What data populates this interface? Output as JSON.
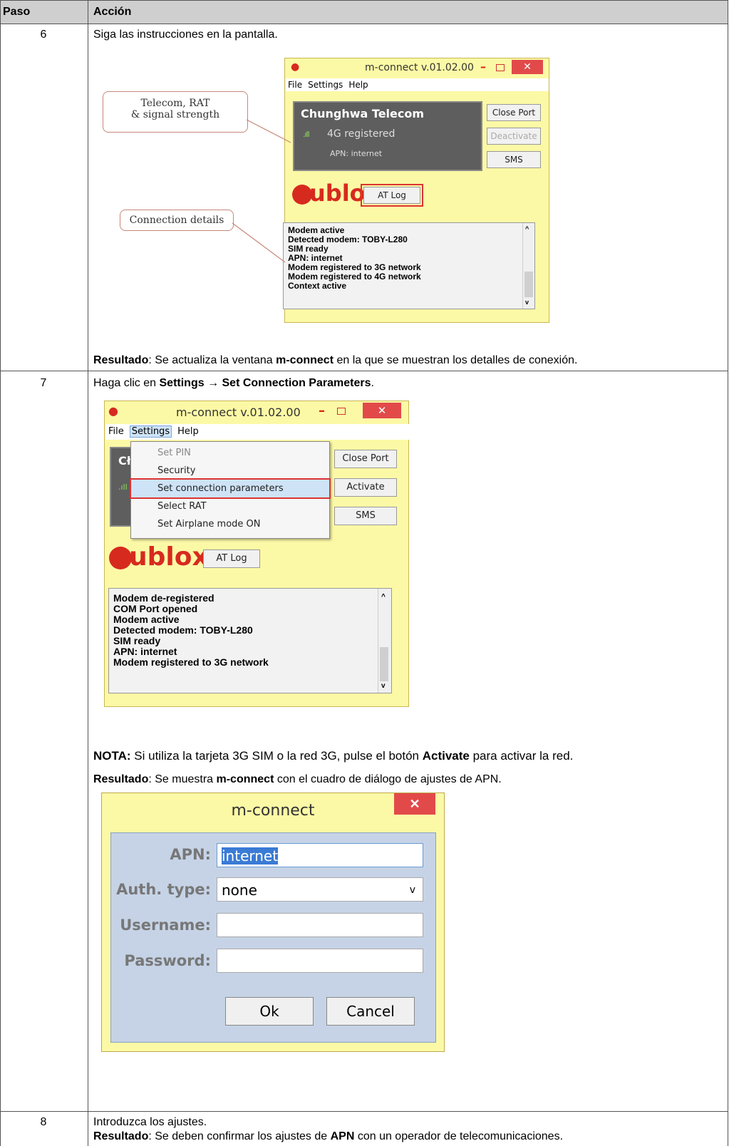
{
  "table": {
    "col_step": "Paso",
    "col_action": "Acción"
  },
  "step6": {
    "num": "6",
    "instruction": "Siga las instrucciones en la pantalla.",
    "result_label": "Resultado",
    "result_pre": ": Se actualiza la ventana ",
    "result_bold": "m-connect",
    "result_post": " en la que se muestran los detalles de conexión.",
    "callout1": "Telecom, RAT & signal strength",
    "callout1_line1": "Telecom, RAT",
    "callout1_line2": "& signal strength",
    "callout2": "Connection details",
    "window": {
      "title": "m-connect v.01.02.00",
      "menu": [
        "File",
        "Settings",
        "Help"
      ],
      "operator": "Chunghwa Telecom",
      "status": "4G registered",
      "apn": "APN: internet",
      "btn_close_port": "Close Port",
      "btn_deactivate": "Deactivate",
      "btn_sms": "SMS",
      "brand": "ublox",
      "btn_at_log": "AT Log",
      "log": [
        "Modem active",
        "Detected modem: TOBY-L280",
        "SIM ready",
        "APN: internet",
        "Modem registered to 3G network",
        "Modem registered to 4G network",
        "Context active"
      ]
    }
  },
  "step7": {
    "num": "7",
    "instr_pre": "Haga clic en ",
    "instr_bold": "Settings → Set Connection Parameters",
    "instr_post": ".",
    "window": {
      "title": "m-connect v.01.02.00",
      "menu": [
        "File",
        "Settings",
        "Help"
      ],
      "operator_partial": "Cł",
      "dropdown": [
        "Set PIN",
        "Security",
        "Set connection parameters",
        "Select RAT",
        "Set Airplane mode ON"
      ],
      "btn_close_port": "Close Port",
      "btn_activate": "Activate",
      "btn_sms": "SMS",
      "brand": "ublox",
      "btn_at_log": "AT Log",
      "log": [
        "Modem de-registered",
        "COM Port opened",
        "Modem active",
        "Detected modem: TOBY-L280",
        "SIM ready",
        "APN: internet",
        "Modem registered to 3G network"
      ]
    },
    "note_label": "NOTA:",
    "note_pre": " Si utiliza la tarjeta 3G SIM o la red 3G, pulse el botón ",
    "note_bold": "Activate",
    "note_post": " para activar la red.",
    "result_label": "Resultado",
    "result_pre": ": Se muestra ",
    "result_bold": "m-connect",
    "result_post": " con el cuadro de diálogo de ajustes de APN.",
    "dialog": {
      "title": "m-connect",
      "apn_label": "APN:",
      "apn_value": "internet",
      "auth_label": "Auth. type:",
      "auth_value": "none",
      "user_label": "Username:",
      "pass_label": "Password:",
      "ok": "Ok",
      "cancel": "Cancel"
    }
  },
  "step8": {
    "num": "8",
    "instruction": "Introduzca los ajustes.",
    "result_label": "Resultado",
    "result_pre": ": Se deben confirmar los ajustes de ",
    "result_bold": "APN",
    "result_post": " con un operador de telecomunicaciones."
  }
}
